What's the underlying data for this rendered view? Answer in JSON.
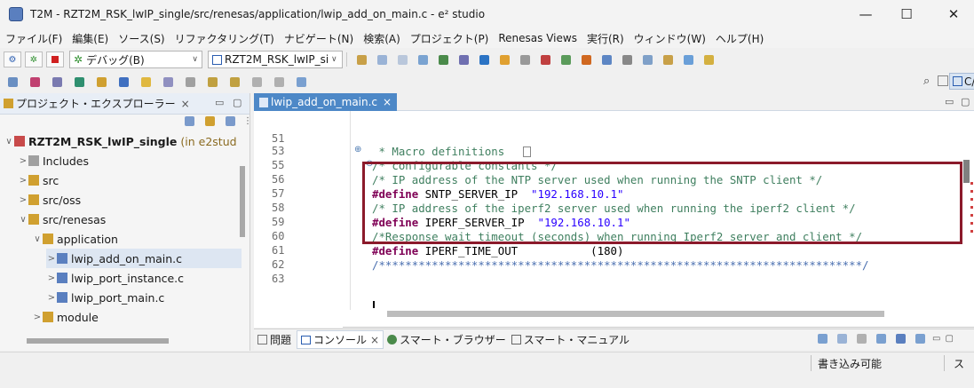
{
  "window": {
    "title": "T2M - RZT2M_RSK_lwIP_single/src/renesas/application/lwip_add_on_main.c - e² studio",
    "minimize": "—",
    "maximize": "☐",
    "close": "✕"
  },
  "menu": [
    "ファイル(F)",
    "編集(E)",
    "ソース(S)",
    "リファクタリング(T)",
    "ナビゲート(N)",
    "検索(A)",
    "プロジェクト(P)",
    "Renesas Views",
    "実行(R)",
    "ウィンドウ(W)",
    "ヘルプ(H)"
  ],
  "toolbar": {
    "debug_combo": "デバッグ(B)",
    "project_combo": "RZT2M_RSK_lwIP_single",
    "perspective_label": "C/C++"
  },
  "explorer": {
    "tab_label": "プロジェクト・エクスプローラー",
    "tab_close": "×",
    "items": [
      {
        "label": "RZT2M_RSK_lwIP_single",
        "suffix": "(in e2stud",
        "chev": "∨"
      },
      {
        "label": "Includes",
        "chev": ">"
      },
      {
        "label": "src",
        "chev": ">"
      },
      {
        "label": "src/oss",
        "chev": ">"
      },
      {
        "label": "src/renesas",
        "chev": "∨"
      },
      {
        "label": "application",
        "chev": "∨"
      },
      {
        "label": "lwip_add_on_main.c",
        "chev": ">"
      },
      {
        "label": "lwip_port_instance.c",
        "chev": ">"
      },
      {
        "label": "lwip_port_main.c",
        "chev": ">"
      },
      {
        "label": "module",
        "chev": ">"
      }
    ]
  },
  "editor": {
    "tab_label": "lwip_add_on_main.c",
    "tab_close": "×",
    "lines": [
      {
        "n": "51",
        "text": ""
      },
      {
        "n": "53",
        "text": " * Macro definitions"
      },
      {
        "n": "55",
        "text": "/* configurable constants */"
      },
      {
        "n": "56",
        "text": "/* IP address of the NTP server used when running the SNTP client */"
      },
      {
        "n": "57",
        "kw": "#define",
        "name": " SNTP_SERVER_IP  ",
        "str": "\"192.168.10.1\""
      },
      {
        "n": "58",
        "text": "/* IP address of the iperf2 server used when running the iperf2 client */"
      },
      {
        "n": "59",
        "kw": "#define",
        "name": " IPERF_SERVER_IP  ",
        "str": "\"192.168.10.1\""
      },
      {
        "n": "60",
        "text": "/*Response wait timeout (seconds) when running Iperf2 server and client */"
      },
      {
        "n": "61",
        "kw": "#define",
        "name": " IPERF_TIME_OUT           (180)"
      },
      {
        "n": "62",
        "text": "/*************************************************************************/"
      },
      {
        "n": "63",
        "text": ""
      }
    ]
  },
  "console": {
    "tabs": [
      "問題",
      "コンソール",
      "スマート・ブラウザー",
      "スマート・マニュアル"
    ],
    "close": "×"
  },
  "status": {
    "writable": "書き込み可能",
    "mode": "ス"
  }
}
